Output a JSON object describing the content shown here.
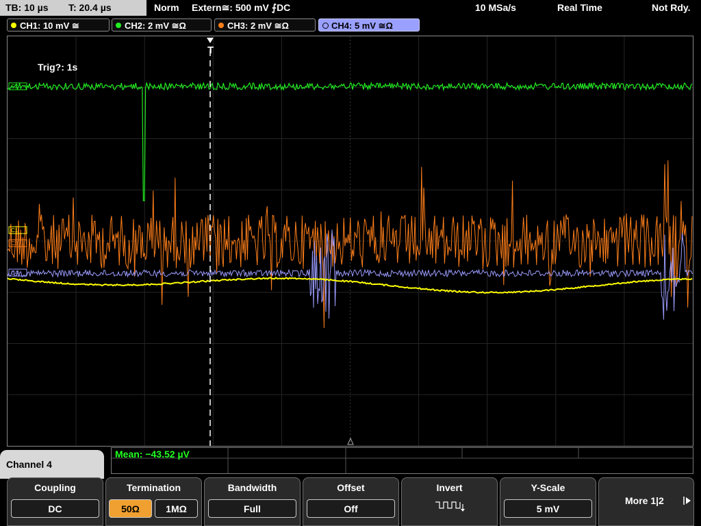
{
  "status": {
    "timebase": "TB: 10 µs",
    "trigger_time": "T: 20.4 µs",
    "mode": "Norm",
    "trigger_source": "Extern≅: 500 mV ⨍DC",
    "sample_rate": "10 MSa/s",
    "acq_mode": "Real Time",
    "run_state": "Not Rdy."
  },
  "channels": [
    {
      "label": "CH1: 10 mV ≅",
      "color": "#ffff00"
    },
    {
      "label": "CH2: 2 mV ≅Ω",
      "color": "#22ee22"
    },
    {
      "label": "CH3: 2 mV ≅Ω",
      "color": "#ff7f1a"
    },
    {
      "label": "CH4: 5 mV ≅Ω",
      "color": "#9b9bff"
    }
  ],
  "trigger_note": "Trig?: 1s",
  "trigger_marker": "T",
  "channel_markers": [
    "C1",
    "C2",
    "C3",
    "C4"
  ],
  "active_channel": "Channel 4",
  "measurement": "Mean: −43.52 µV",
  "softkeys": [
    {
      "title": "Coupling",
      "value": "DC"
    },
    {
      "title": "Termination",
      "options": [
        "50Ω",
        "1MΩ"
      ],
      "selected": "50Ω"
    },
    {
      "title": "Bandwidth",
      "value": "Full"
    },
    {
      "title": "Offset",
      "value": "Off"
    },
    {
      "title": "Invert",
      "icon": "invert-wave-icon"
    },
    {
      "title": "Y-Scale",
      "value": "5 mV"
    },
    {
      "title": "More 1|2",
      "icon": "arrow-right-icon"
    }
  ]
}
